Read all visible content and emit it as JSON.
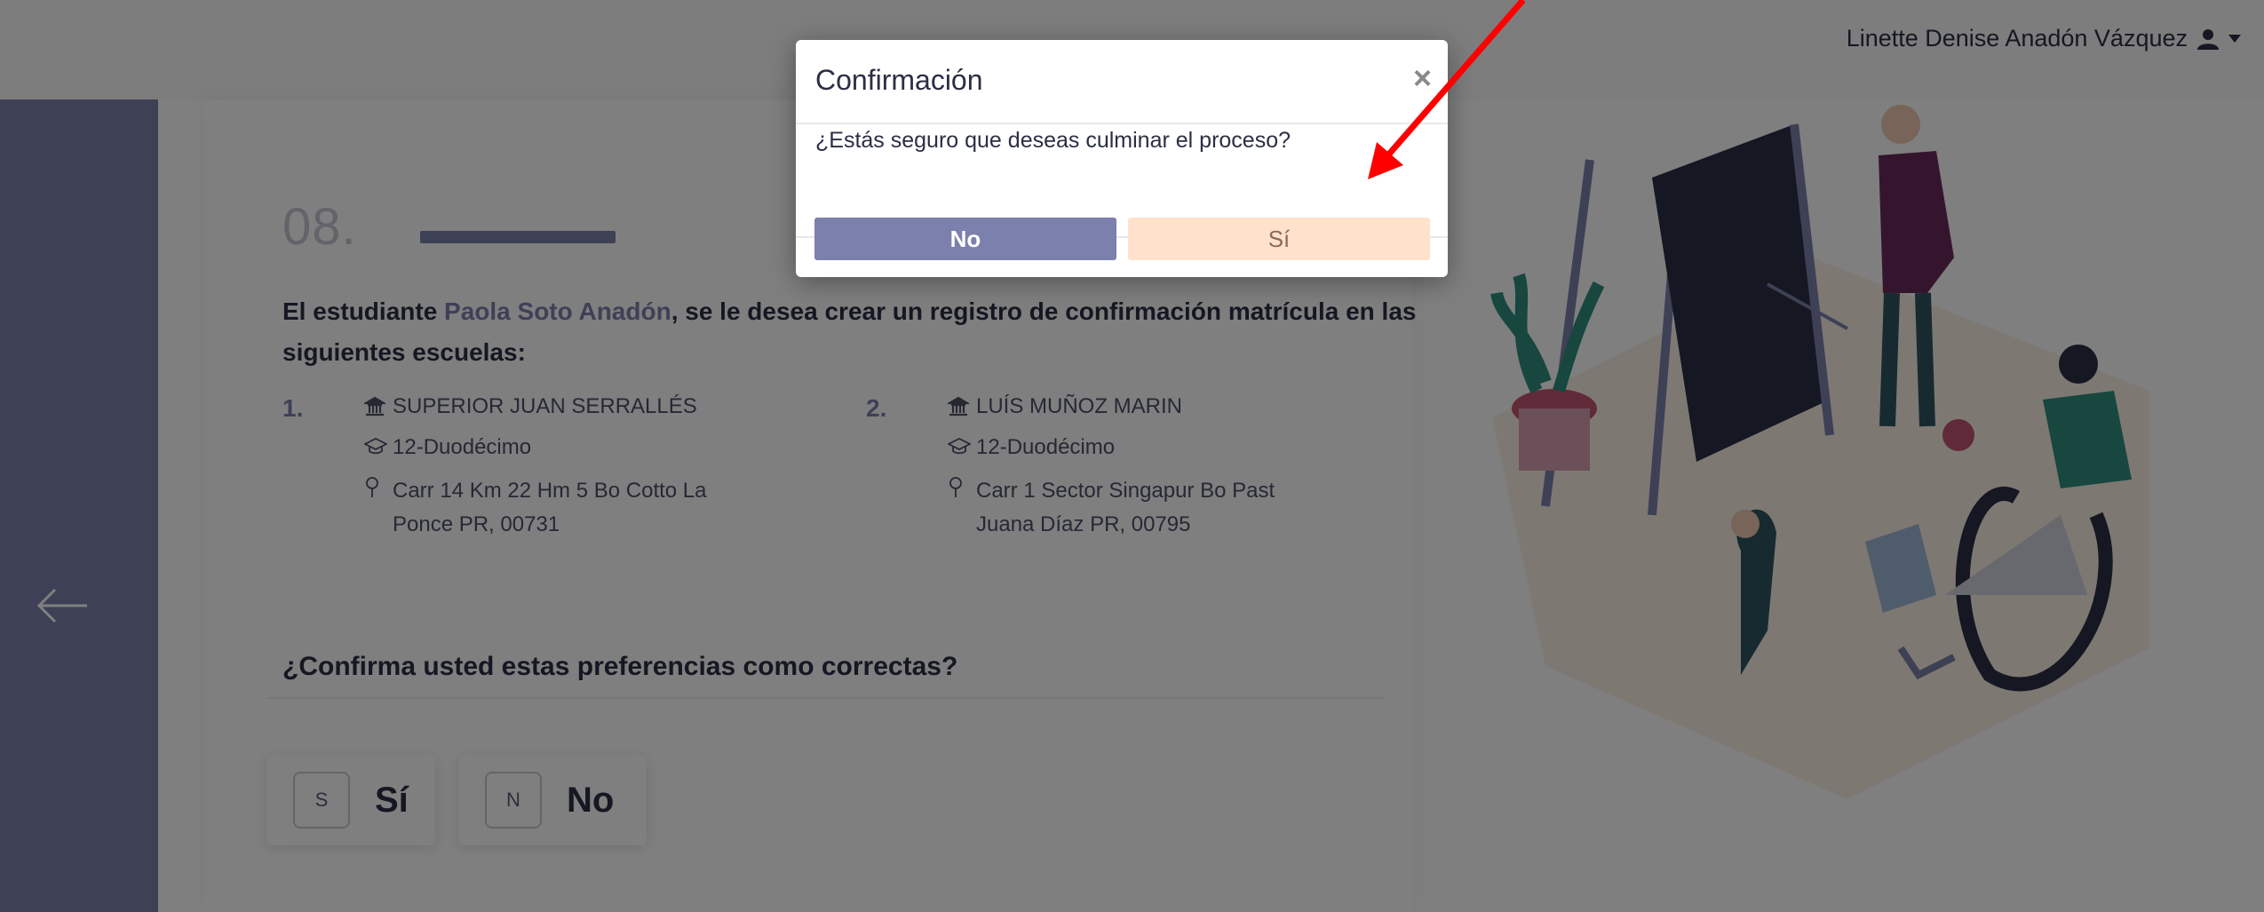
{
  "user": {
    "name": "Linette Denise Anadón Vázquez",
    "icon": "user-icon"
  },
  "step": {
    "number": "08."
  },
  "intro": {
    "prefix": "El estudiante ",
    "student_name": "Paola Soto Anadón",
    "suffix": ", se le desea crear un registro de confirmación matrícula en las siguientes escuelas:"
  },
  "schools": [
    {
      "num": "1.",
      "name": "SUPERIOR JUAN SERRALLÉS",
      "grade": "12-Duodécimo",
      "address1": "Carr 14 Km 22 Hm 5 Bo Cotto La",
      "address2": "Ponce PR, 00731"
    },
    {
      "num": "2.",
      "name": "LUÍS MUÑOZ MARIN",
      "grade": "12-Duodécimo",
      "address1": "Carr 1 Sector Singapur Bo Past",
      "address2": "Juana Díaz PR, 00795"
    }
  ],
  "question": "¿Confirma usted estas preferencias como correctas?",
  "options": [
    {
      "key": "S",
      "label": "Sí"
    },
    {
      "key": "N",
      "label": "No"
    }
  ],
  "modal": {
    "title": "Confirmación",
    "close": "×",
    "message": "¿Estás seguro que deseas culminar el proceso?",
    "no_label": "No",
    "yes_label": "Sí"
  },
  "colors": {
    "accent": "#7c80ad",
    "yes_button": "#ffe1cc",
    "annotation_arrow": "#ff0000"
  }
}
